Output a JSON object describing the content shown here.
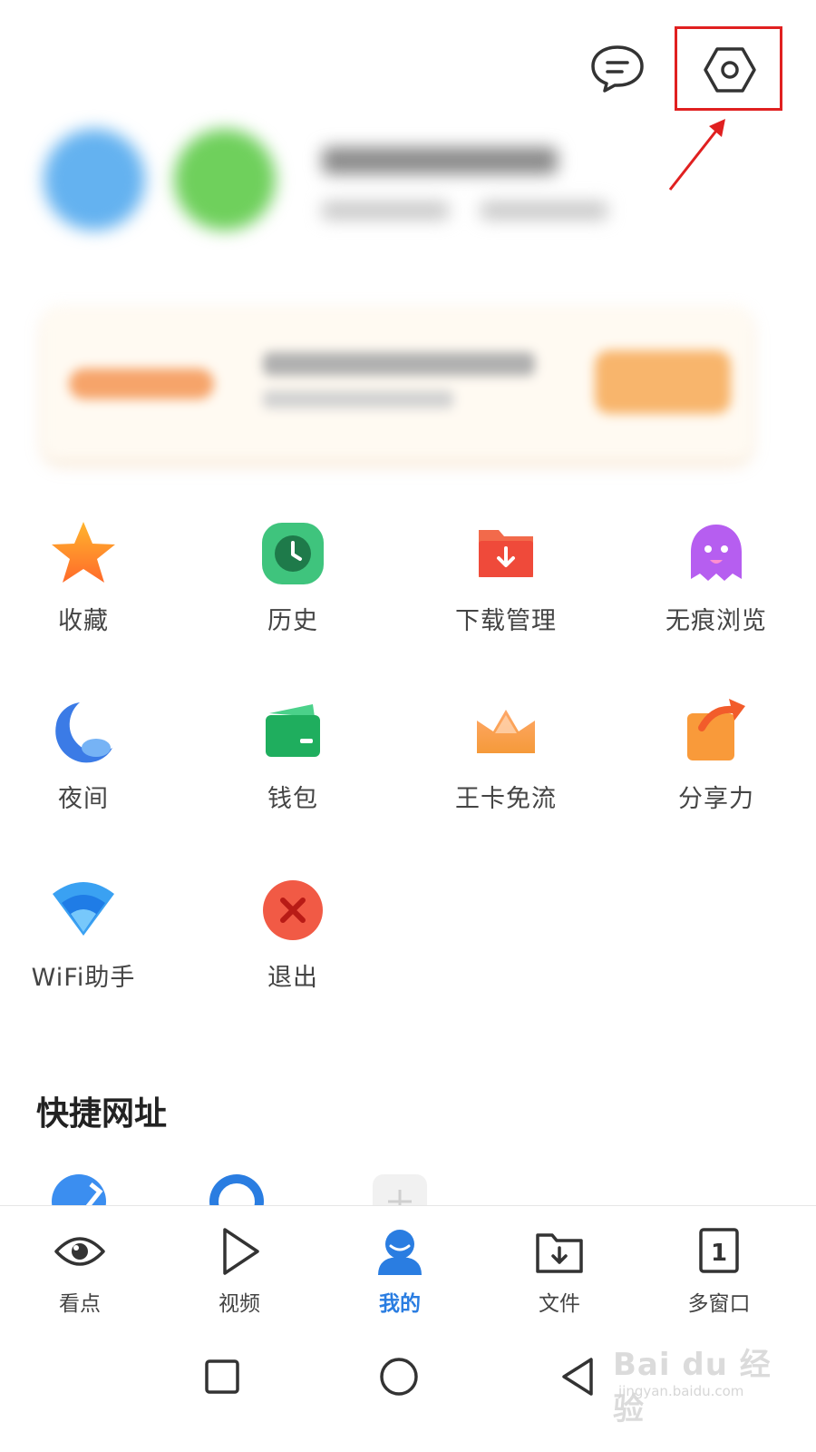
{
  "header": {
    "message_icon": "chat-bubble-icon",
    "settings_icon": "hexagon-settings-icon",
    "highlight_color": "#e02020"
  },
  "grid": {
    "items": [
      {
        "label": "收藏",
        "icon": "star-icon"
      },
      {
        "label": "历史",
        "icon": "clock-icon"
      },
      {
        "label": "下载管理",
        "icon": "download-folder-icon"
      },
      {
        "label": "无痕浏览",
        "icon": "ghost-icon"
      },
      {
        "label": "夜间",
        "icon": "moon-icon"
      },
      {
        "label": "钱包",
        "icon": "wallet-icon"
      },
      {
        "label": "王卡免流",
        "icon": "crown-icon"
      },
      {
        "label": "分享力",
        "icon": "share-box-icon"
      },
      {
        "label": "WiFi助手",
        "icon": "wifi-icon"
      },
      {
        "label": "退出",
        "icon": "exit-icon"
      }
    ]
  },
  "quick_urls": {
    "title": "快捷网址"
  },
  "bottom_nav": {
    "items": [
      {
        "label": "看点",
        "icon": "eye-icon",
        "active": false
      },
      {
        "label": "视频",
        "icon": "play-icon",
        "active": false
      },
      {
        "label": "我的",
        "icon": "user-icon",
        "active": true
      },
      {
        "label": "文件",
        "icon": "file-folder-icon",
        "active": false
      },
      {
        "label": "多窗口",
        "icon": "window-count-icon",
        "active": false,
        "badge": "1"
      }
    ],
    "active_color": "#2a7de1"
  },
  "watermark": {
    "brand": "Bai du 经验",
    "url": "jingyan.baidu.com"
  }
}
